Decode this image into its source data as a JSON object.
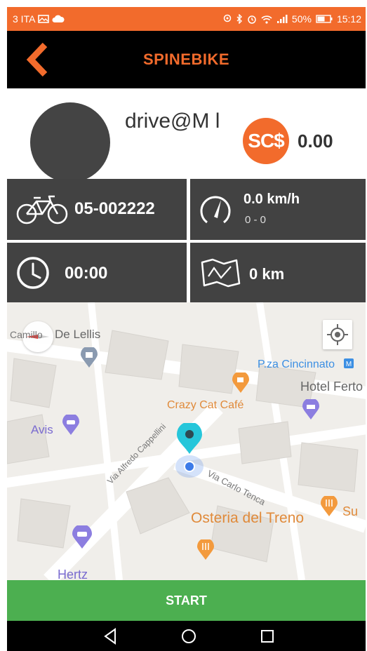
{
  "status_bar": {
    "carrier": "3 ITA",
    "battery": "50%",
    "time": "15:12"
  },
  "header": {
    "title": "SPINEBIKE"
  },
  "profile": {
    "username": "drive@M l",
    "coin_symbol": "SC$",
    "balance": "0.00"
  },
  "stats": {
    "bike_id": "05-002222",
    "speed": "0.0 km/h",
    "speed_range": "0 - 0",
    "duration": "00:00",
    "distance": "0 km"
  },
  "map": {
    "labels": {
      "street_de_lellis": "De Lellis",
      "street_camillo": "Camillo",
      "pza_cincinnato": "P.za Cincinnato",
      "hotel": "Hotel Ferto",
      "crazy_cat": "Crazy Cat Café",
      "avis": "Avis",
      "via_cappellini": "Via Alfredo Cappellini",
      "via_tenca": "Via Carlo Tenca",
      "osteria": "Osteria del Treno",
      "su": "Su",
      "hertz": "Hertz"
    },
    "colors": {
      "poi_orange": "#f39a3d",
      "poi_purple": "#8c7ee0",
      "poi_blue": "#3c8fe3",
      "marker_teal": "#26c6da",
      "user_dot": "#3d7be8"
    }
  },
  "actions": {
    "start_label": "START"
  },
  "colors": {
    "accent": "#f26b2c",
    "tile_bg": "#424242",
    "start_green": "#4caf50"
  }
}
